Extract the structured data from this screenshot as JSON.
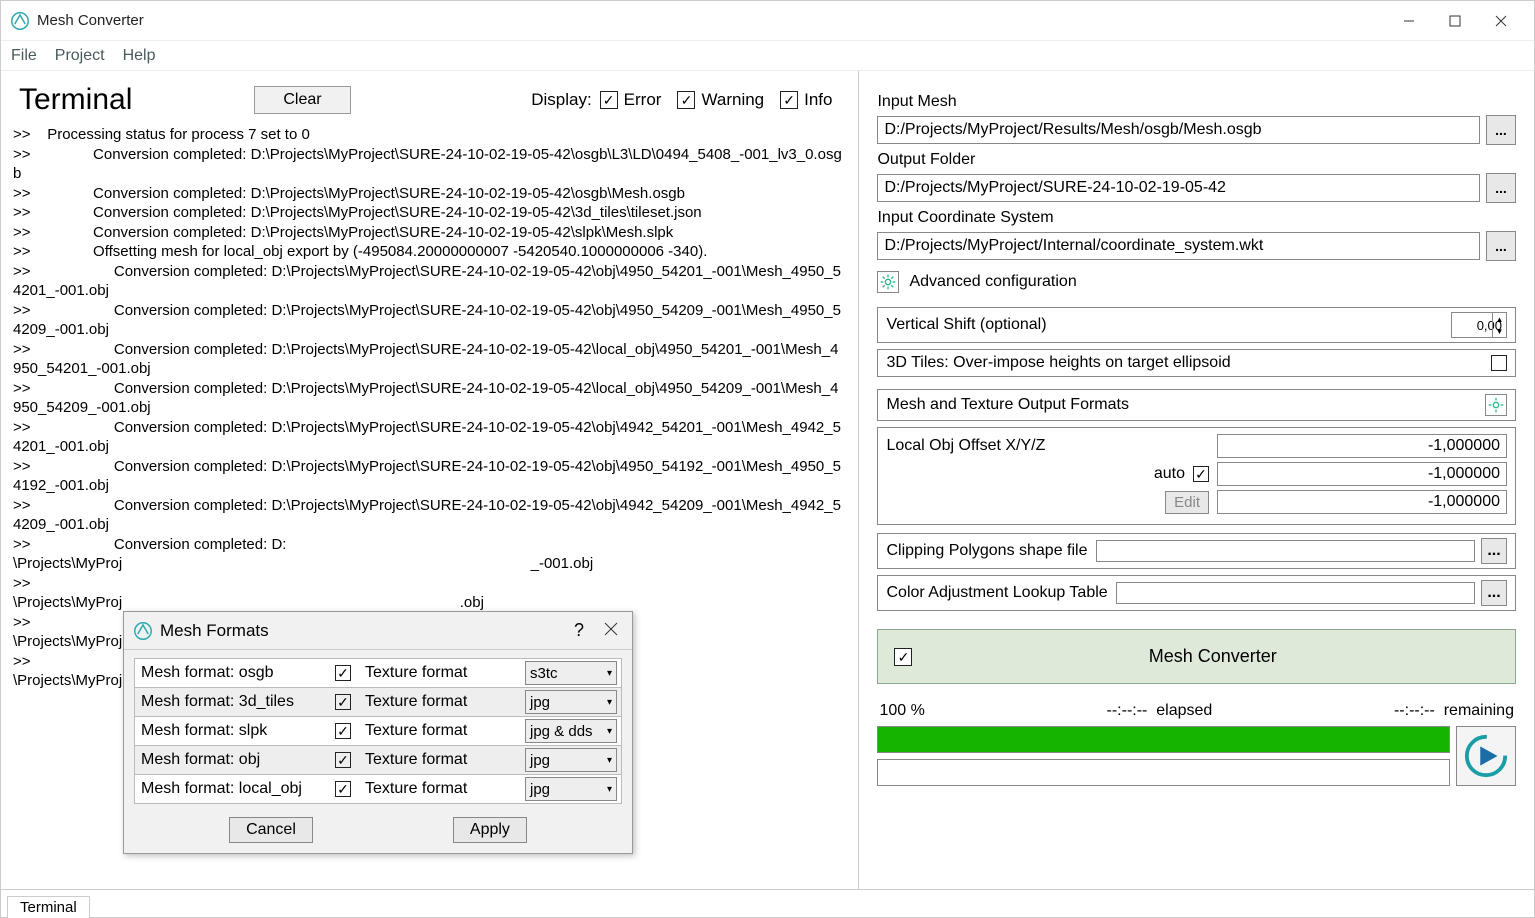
{
  "window": {
    "title": "Mesh Converter"
  },
  "menu": {
    "file": "File",
    "project": "Project",
    "help": "Help"
  },
  "terminal": {
    "title": "Terminal",
    "clear": "Clear",
    "display_label": "Display:",
    "filters": {
      "error": "Error",
      "warning": "Warning",
      "info": "Info"
    },
    "lines": [
      ">>    Processing status for process 7 set to 0",
      ">>               Conversion completed: D:\\Projects\\MyProject\\SURE-24-10-02-19-05-42\\osgb\\L3\\LD\\0494_5408_-001_lv3_0.osgb",
      ">>               Conversion completed: D:\\Projects\\MyProject\\SURE-24-10-02-19-05-42\\osgb\\Mesh.osgb",
      ">>               Conversion completed: D:\\Projects\\MyProject\\SURE-24-10-02-19-05-42\\3d_tiles\\tileset.json",
      ">>               Conversion completed: D:\\Projects\\MyProject\\SURE-24-10-02-19-05-42\\slpk\\Mesh.slpk",
      ">>               Offsetting mesh for local_obj export by (-495084.20000000007 -5420540.1000000006 -340).",
      ">>                    Conversion completed: D:\\Projects\\MyProject\\SURE-24-10-02-19-05-42\\obj\\4950_54201_-001\\Mesh_4950_54201_-001.obj",
      ">>                    Conversion completed: D:\\Projects\\MyProject\\SURE-24-10-02-19-05-42\\obj\\4950_54209_-001\\Mesh_4950_54209_-001.obj",
      ">>                    Conversion completed: D:\\Projects\\MyProject\\SURE-24-10-02-19-05-42\\local_obj\\4950_54201_-001\\Mesh_4950_54201_-001.obj",
      ">>                    Conversion completed: D:\\Projects\\MyProject\\SURE-24-10-02-19-05-42\\local_obj\\4950_54209_-001\\Mesh_4950_54209_-001.obj",
      ">>                    Conversion completed: D:\\Projects\\MyProject\\SURE-24-10-02-19-05-42\\obj\\4942_54201_-001\\Mesh_4942_54201_-001.obj",
      ">>                    Conversion completed: D:\\Projects\\MyProject\\SURE-24-10-02-19-05-42\\obj\\4950_54192_-001\\Mesh_4950_54192_-001.obj",
      ">>                    Conversion completed: D:\\Projects\\MyProject\\SURE-24-10-02-19-05-42\\obj\\4942_54209_-001\\Mesh_4942_54209_-001.obj",
      ">>                    Conversion completed: D:",
      "\\Projects\\MyProj                                                                                                  _-001.obj",
      ">>",
      "\\Projects\\MyProj                                                                                 .obj",
      ">>",
      "\\Projects\\MyProj                                                                                                  _-001.obj",
      ">>",
      "\\Projects\\MyProj                                                                                                  _-001.obj"
    ]
  },
  "footer_tab": "Terminal",
  "panel": {
    "input_mesh": {
      "label": "Input Mesh",
      "value": "D:/Projects/MyProject/Results/Mesh/osgb/Mesh.osgb"
    },
    "output_folder": {
      "label": "Output Folder",
      "value": "D:/Projects/MyProject/SURE-24-10-02-19-05-42"
    },
    "coord_sys": {
      "label": "Input Coordinate System",
      "value": "D:/Projects/MyProject/Internal/coordinate_system.wkt"
    },
    "advanced": "Advanced configuration",
    "vshift": {
      "label": "Vertical Shift (optional)",
      "value": "0,00"
    },
    "overimpose": "3D Tiles: Over-impose heights on target ellipsoid",
    "formats_header": "Mesh and Texture Output Formats",
    "offset": {
      "label": "Local Obj Offset X/Y/Z",
      "auto": "auto",
      "edit": "Edit",
      "x": "-1,000000",
      "y": "-1,000000",
      "z": "-1,000000"
    },
    "clipping": "Clipping Polygons shape file",
    "color_lut": "Color Adjustment Lookup Table",
    "converter": "Mesh Converter",
    "status": {
      "percent": "100  %",
      "elapsed_time": "--:--:--",
      "elapsed": "elapsed",
      "remaining_time": "--:--:--",
      "remaining": "remaining"
    },
    "browse": "..."
  },
  "dialog": {
    "title": "Mesh Formats",
    "help": "?",
    "rows": [
      {
        "mesh": "Mesh format: osgb",
        "tex_label": "Texture format",
        "tex": "s3tc"
      },
      {
        "mesh": "Mesh format: 3d_tiles",
        "tex_label": "Texture format",
        "tex": "jpg"
      },
      {
        "mesh": "Mesh format: slpk",
        "tex_label": "Texture format",
        "tex": "jpg & dds"
      },
      {
        "mesh": "Mesh format: obj",
        "tex_label": "Texture format",
        "tex": "jpg"
      },
      {
        "mesh": "Mesh format: local_obj",
        "tex_label": "Texture format",
        "tex": "jpg"
      }
    ],
    "cancel": "Cancel",
    "apply": "Apply"
  }
}
